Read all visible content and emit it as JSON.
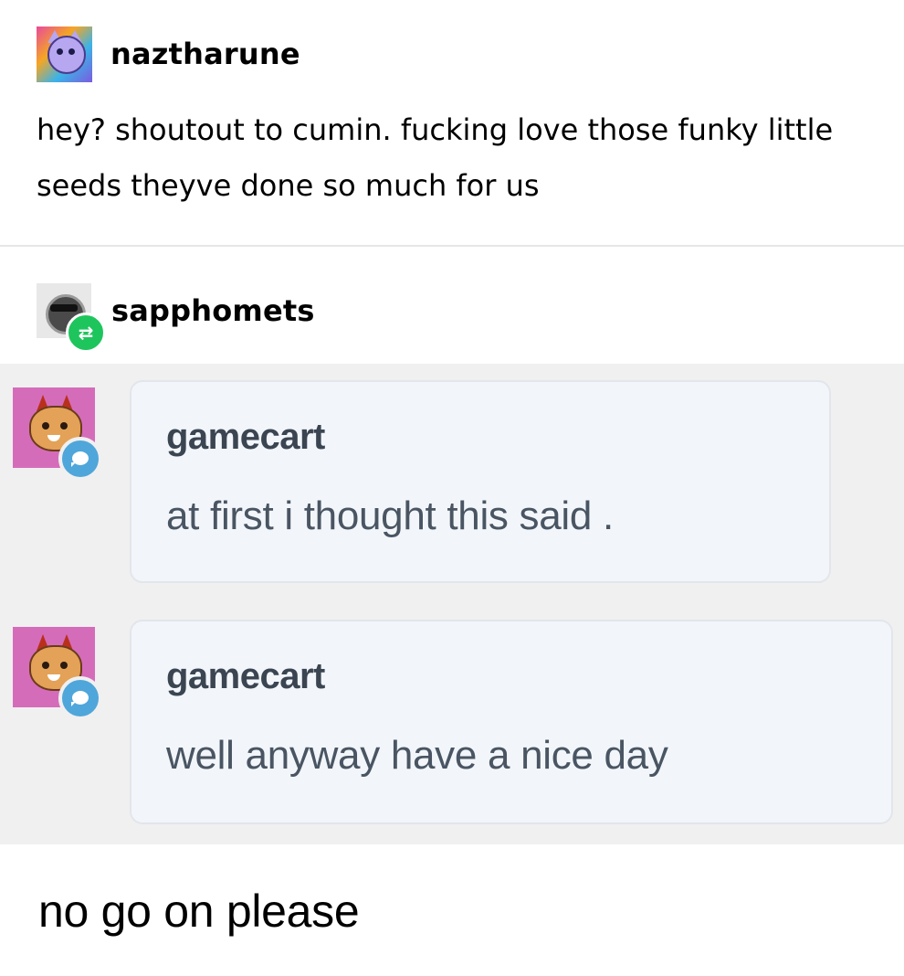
{
  "original_post": {
    "username": "naztharune",
    "avatar_icon": "cat-avatar-icon",
    "text": "hey? shoutout to cumin. fucking love those funky little seeds theyve done so much for us"
  },
  "reblog": {
    "username": "sapphomets",
    "avatar_icon": "sunglasses-avatar-icon",
    "badge_icon": "reblog-icon",
    "badge_color": "#1ec55c"
  },
  "comments": [
    {
      "username": "gamecart",
      "text": "at first i thought this said .",
      "avatar_icon": "devil-cat-avatar-icon",
      "badge_icon": "reply-bubble-icon",
      "badge_color": "#4fa6da"
    },
    {
      "username": "gamecart",
      "text": "well anyway have a nice day",
      "avatar_icon": "devil-cat-avatar-icon",
      "badge_icon": "reply-bubble-icon",
      "badge_color": "#4fa6da"
    }
  ],
  "caption": "no go on please",
  "colors": {
    "comments_panel_bg": "#f0f0f0",
    "comment_card_bg": "#f2f6fa",
    "comment_text": "#4a5563",
    "comment_name": "#3b4552"
  }
}
